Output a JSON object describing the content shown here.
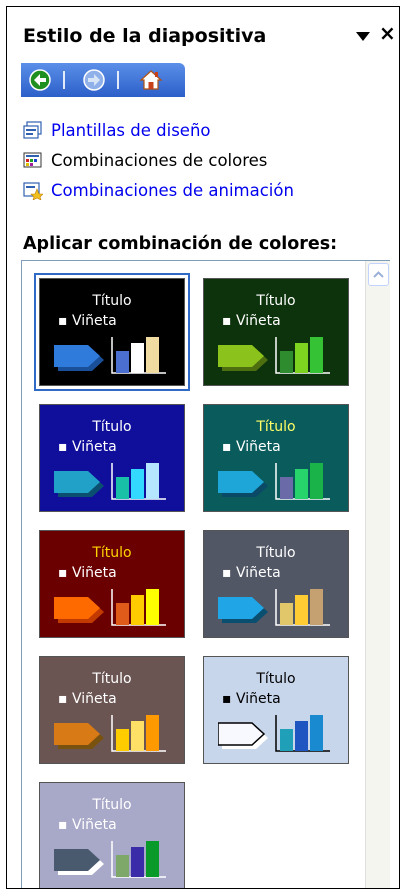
{
  "pane": {
    "title": "Estilo de la diapositiva",
    "dropdown_icon": "triangle-down-icon",
    "close_label": "×"
  },
  "nav": {
    "back_icon": "back-arrow-icon",
    "forward_icon": "forward-arrow-icon",
    "home_icon": "home-icon"
  },
  "links": [
    {
      "label": "Plantillas de diseño",
      "icon": "design-templates-icon",
      "color": "#0000ee"
    },
    {
      "label": "Combinaciones de colores",
      "icon": "color-schemes-icon",
      "color": "#000000"
    },
    {
      "label": "Combinaciones de animación",
      "icon": "animation-schemes-icon",
      "color": "#0000ee"
    }
  ],
  "section_heading": "Aplicar combinación de colores:",
  "scheme_text": {
    "title": "Título",
    "bullet": "▪ Viñeta"
  },
  "schemes": [
    {
      "bg": "#000000",
      "title_color": "#ffffff",
      "text_color": "#ffffff",
      "arrow": "#2f7bdc",
      "arrow_shadow": "#1a4f99",
      "bars": [
        "#4a6fd0",
        "#ffffff",
        "#f0dca0"
      ],
      "selected": true
    },
    {
      "bg": "#0c330c",
      "title_color": "#ffffff",
      "text_color": "#ffffff",
      "arrow": "#8bc31c",
      "arrow_shadow": "#4e6f10",
      "bars": [
        "#2e8b2e",
        "#7ed321",
        "#35c235"
      ],
      "selected": false
    },
    {
      "bg": "#0f0f9c",
      "title_color": "#ffffff",
      "text_color": "#ffffff",
      "arrow": "#21a0c8",
      "arrow_shadow": "#0a4f70",
      "bars": [
        "#19c0a8",
        "#33d9ff",
        "#b5e6ff"
      ],
      "selected": false
    },
    {
      "bg": "#0a5b5b",
      "title_color": "#ffff66",
      "text_color": "#ffffff",
      "arrow": "#1fa6d8",
      "arrow_shadow": "#0a4a66",
      "bars": [
        "#6a6aa8",
        "#27d46c",
        "#1ab34a"
      ],
      "selected": false
    },
    {
      "bg": "#6b0000",
      "title_color": "#ffd400",
      "text_color": "#ffffff",
      "arrow": "#ff6a00",
      "arrow_shadow": "#c33a00",
      "bars": [
        "#e05a1a",
        "#ffcc00",
        "#ffff00"
      ],
      "selected": false
    },
    {
      "bg": "#525766",
      "title_color": "#ffffff",
      "text_color": "#ffffff",
      "arrow": "#20a6e6",
      "arrow_shadow": "#0a4f70",
      "bars": [
        "#e2c66a",
        "#ffcc33",
        "#c5a070"
      ],
      "selected": false
    },
    {
      "bg": "#6b5552",
      "title_color": "#ffffff",
      "text_color": "#ffffff",
      "arrow": "#d87a16",
      "arrow_shadow": "#7a5210",
      "bars": [
        "#ffcc00",
        "#ffe066",
        "#ff9900"
      ],
      "selected": false
    },
    {
      "bg": "#c8d6ec",
      "title_color": "#000000",
      "text_color": "#000000",
      "arrow": "#f8f8ff",
      "arrow_shadow": "#ffffff",
      "bars": [
        "#1fa0b8",
        "#1f55c0",
        "#1a8ad0"
      ],
      "selected": false
    },
    {
      "bg": "#a8a8c8",
      "title_color": "#ffffff",
      "text_color": "#ffffff",
      "arrow": "#4a5a6e",
      "arrow_shadow": "#ffffff",
      "bars": [
        "#7ea86a",
        "#3a2ca8",
        "#0a9a2a"
      ],
      "selected": false
    }
  ]
}
